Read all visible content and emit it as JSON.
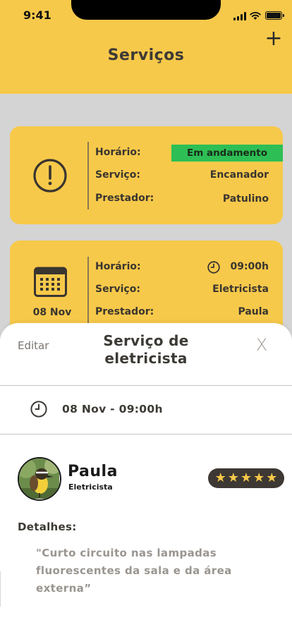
{
  "status_bar": {
    "time": "9:41"
  },
  "header": {
    "title": "Serviços",
    "add_label": "+"
  },
  "cards": [
    {
      "icon": "alert-circle-icon",
      "status": "Em andamento",
      "rows": [
        {
          "label": "Horário:",
          "value": ""
        },
        {
          "label": "Serviço:",
          "value": "Encanador"
        },
        {
          "label": "Prestador:",
          "value": "Patulino"
        }
      ]
    },
    {
      "icon": "calendar-icon",
      "date": "08 Nov",
      "rows": [
        {
          "label": "Horário:",
          "value": "09:00h",
          "icon": "clock-icon"
        },
        {
          "label": "Serviço:",
          "value": "Eletricista"
        },
        {
          "label": "Prestador:",
          "value": "Paula"
        }
      ]
    }
  ],
  "sheet": {
    "edit_label": "Editar",
    "title": "Serviço de eletricista",
    "close_label": "X",
    "datetime": "08 Nov - 09:00h",
    "provider": {
      "name": "Paula",
      "role": "Eletricista",
      "rating": 5
    },
    "details_label": "Detalhes:",
    "details_text": "\"Curto circuito nas lampadas fluorescentes da sala e da área externa”"
  },
  "colors": {
    "accent": "#f7c94a",
    "status_green": "#2dbf55",
    "dark": "#3d3833",
    "backdrop": "#d4d4d4"
  }
}
